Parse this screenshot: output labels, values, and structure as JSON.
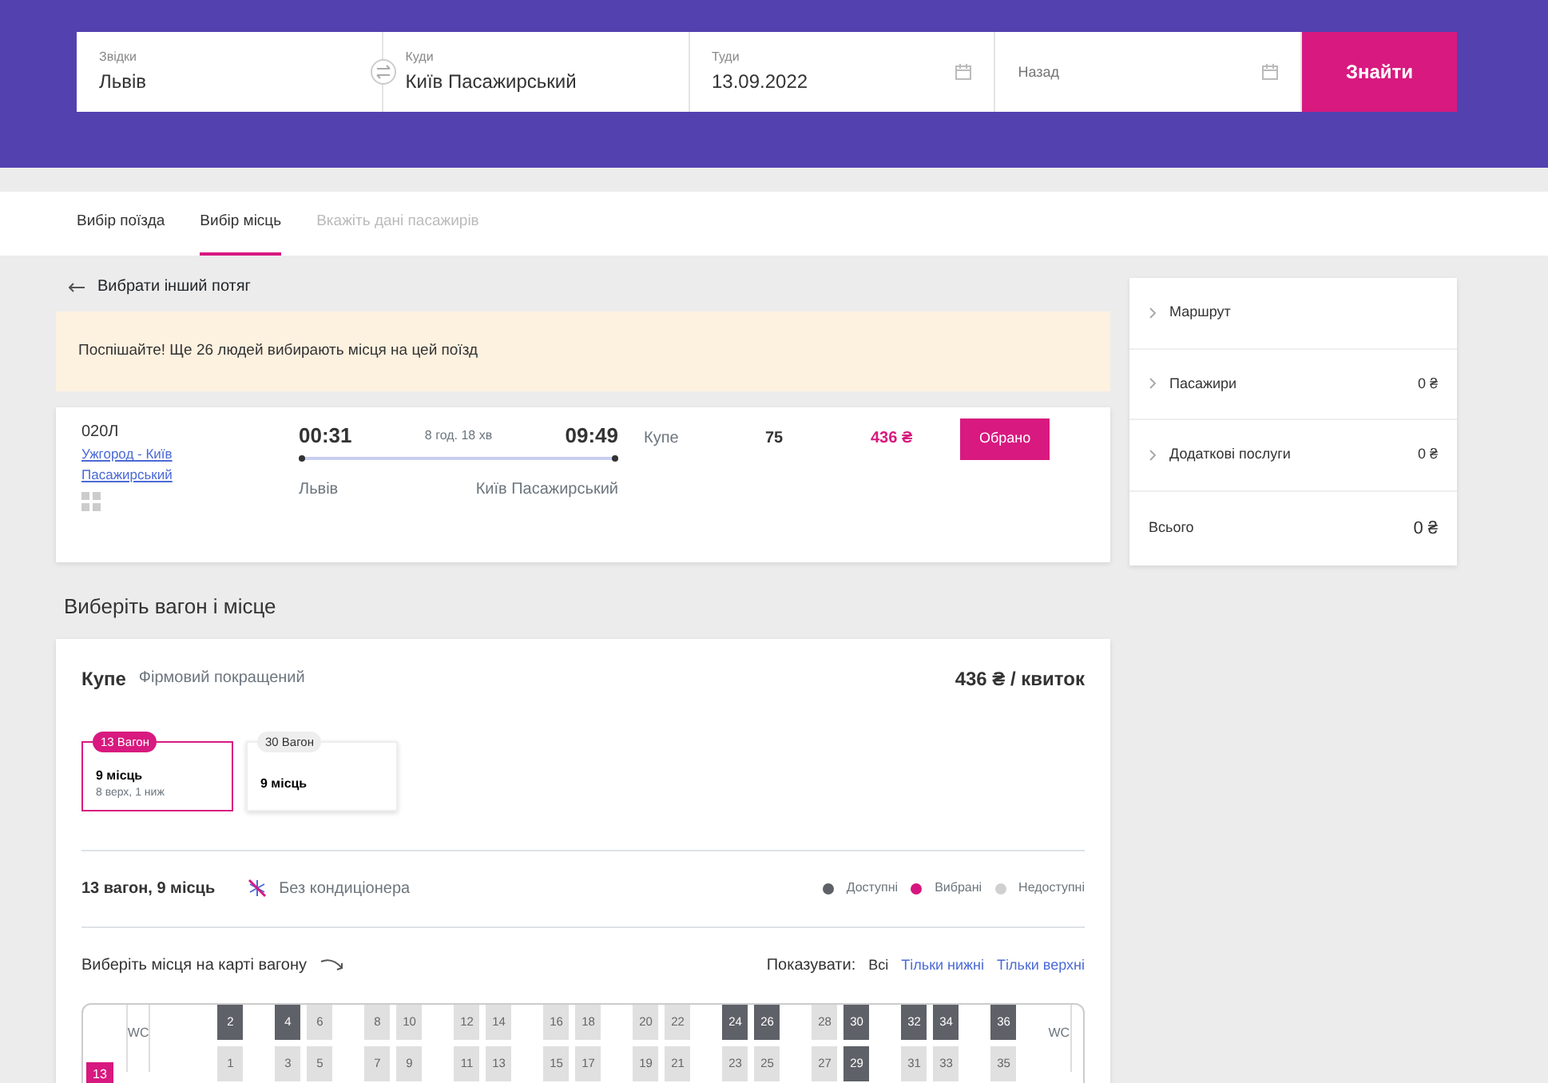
{
  "search": {
    "fields": [
      {
        "label": "Звідки",
        "value": "Львів",
        "kind": "text"
      },
      {
        "label": "Куди",
        "value": "Київ Пасажирський",
        "kind": "text"
      },
      {
        "label": "Туди",
        "value": "13.09.2022",
        "kind": "date"
      },
      {
        "placeholder": "Назад",
        "kind": "date"
      }
    ],
    "button": "Знайти"
  },
  "steps": [
    {
      "label": "Вибір поїзда",
      "selected": false,
      "disabled": false
    },
    {
      "label": "Вибір місць",
      "selected": true,
      "disabled": false
    },
    {
      "label": "Вкажіть дані пасажирів",
      "selected": false,
      "disabled": true
    }
  ],
  "back_link": "Вибрати інший потяг",
  "alert": "Поспішайте! Ще 26 людей вибирають місця на цей поїзд",
  "train": {
    "number": "020Л",
    "route": "Ужгород - Київ Пасажирський",
    "departure": "00:31",
    "duration": "8 год. 18 хв",
    "arrival": "09:49",
    "from": "Львів",
    "to": "Київ Пасажирський",
    "class": "Купе",
    "seats": "75",
    "price": "436 ₴",
    "button": "Обрано"
  },
  "section_title": "Виберіть вагон і місце",
  "car_class": {
    "name": "Купе",
    "subtitle": "Фірмовий покращений",
    "price": "436 ₴ / квиток"
  },
  "cars": [
    {
      "badge": "13 Вагон",
      "seats": "9 місць",
      "detail": "8 верх, 1 ниж",
      "selected": true
    },
    {
      "badge": "30 Вагон",
      "seats": "9 місць",
      "selected": false
    }
  ],
  "car_info": {
    "title": "13 вагон, 9 місць",
    "feature": "Без кондиціонера"
  },
  "legend": [
    {
      "label": "Доступні",
      "color": "#5f6168"
    },
    {
      "label": "Вибрані",
      "color": "#d6167e"
    },
    {
      "label": "Недоступні",
      "color": "#d0d0d0"
    }
  ],
  "map_hint": "Виберіть місця на карті вагону",
  "filter": {
    "label": "Показувати:",
    "options": [
      {
        "label": "Всі",
        "selected": true
      },
      {
        "label": "Тільки нижні",
        "selected": false
      },
      {
        "label": "Тільки верхні",
        "selected": false
      }
    ]
  },
  "car_map": {
    "car_number": "13",
    "wc_left": "WC",
    "wc_right": "WC",
    "groups": [
      {
        "upper": [
          {
            "number": "2",
            "available": true
          }
        ],
        "lower": [
          {
            "number": "1",
            "available": false
          }
        ]
      },
      {
        "upper": [
          {
            "number": "4",
            "available": true
          },
          {
            "number": "6",
            "available": false
          }
        ],
        "lower": [
          {
            "number": "3",
            "available": false
          },
          {
            "number": "5",
            "available": false
          }
        ]
      },
      {
        "upper": [
          {
            "number": "8",
            "available": false
          },
          {
            "number": "10",
            "available": false
          }
        ],
        "lower": [
          {
            "number": "7",
            "available": false
          },
          {
            "number": "9",
            "available": false
          }
        ]
      },
      {
        "upper": [
          {
            "number": "12",
            "available": false
          },
          {
            "number": "14",
            "available": false
          }
        ],
        "lower": [
          {
            "number": "11",
            "available": false
          },
          {
            "number": "13",
            "available": false
          }
        ]
      },
      {
        "upper": [
          {
            "number": "16",
            "available": false
          },
          {
            "number": "18",
            "available": false
          }
        ],
        "lower": [
          {
            "number": "15",
            "available": false
          },
          {
            "number": "17",
            "available": false
          }
        ]
      },
      {
        "upper": [
          {
            "number": "20",
            "available": false
          },
          {
            "number": "22",
            "available": false
          }
        ],
        "lower": [
          {
            "number": "19",
            "available": false
          },
          {
            "number": "21",
            "available": false
          }
        ]
      },
      {
        "upper": [
          {
            "number": "24",
            "available": true
          },
          {
            "number": "26",
            "available": true
          }
        ],
        "lower": [
          {
            "number": "23",
            "available": false
          },
          {
            "number": "25",
            "available": false
          }
        ]
      },
      {
        "upper": [
          {
            "number": "28",
            "available": false
          },
          {
            "number": "30",
            "available": true
          }
        ],
        "lower": [
          {
            "number": "27",
            "available": false
          },
          {
            "number": "29",
            "available": true
          }
        ]
      },
      {
        "upper": [
          {
            "number": "32",
            "available": true
          },
          {
            "number": "34",
            "available": true
          }
        ],
        "lower": [
          {
            "number": "31",
            "available": false
          },
          {
            "number": "33",
            "available": false
          }
        ]
      },
      {
        "upper": [
          {
            "number": "36",
            "available": true
          }
        ],
        "lower": [
          {
            "number": "35",
            "available": false
          }
        ]
      }
    ]
  },
  "summary": {
    "rows": [
      {
        "label": "Маршрут",
        "expandable": true
      },
      {
        "label": "Пасажири",
        "value": "0 ₴",
        "expandable": true
      },
      {
        "label": "Додаткові послуги",
        "value": "0 ₴",
        "expandable": true
      }
    ],
    "total": {
      "label": "Всього",
      "value": "0 ₴"
    }
  }
}
